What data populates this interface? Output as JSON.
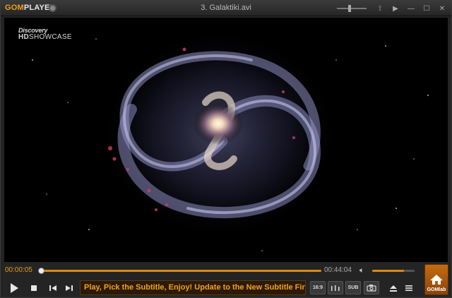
{
  "app": {
    "logo_prefix": "GOM",
    "logo_suffix": "PLAYER"
  },
  "window": {
    "title": "3. Galaktiki.avi"
  },
  "video": {
    "brand_line1": "Discovery",
    "brand_hd": "HD",
    "brand_line2": "SHOWCASE"
  },
  "playback": {
    "current_time": "00:00:05",
    "total_time": "00:44:04",
    "progress_percent": 0.2,
    "volume_percent": 75
  },
  "ticker": {
    "text": "Play, Pick the Subtitle, Enjoy! Update to the New Subtitle Finder"
  },
  "buttons": {
    "aspect_label": "16:9",
    "sub_label": "SUB",
    "gomlab_label": "GOMlab"
  },
  "colors": {
    "accent": "#e89a20",
    "seek": "#d88a18"
  }
}
